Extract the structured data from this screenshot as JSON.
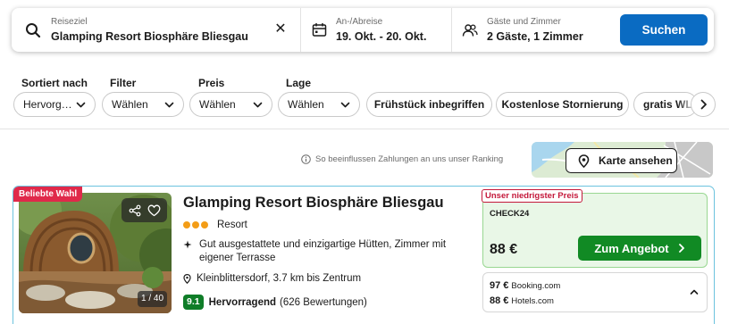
{
  "search": {
    "destination_label": "Reiseziel",
    "destination_value": "Glamping Resort Biosphäre Bliesgau",
    "dates_label": "An-/Abreise",
    "dates_value": "19. Okt. - 20. Okt.",
    "guests_label": "Gäste und Zimmer",
    "guests_value": "2 Gäste, 1 Zimmer",
    "clear_symbol": "✕",
    "search_button": "Suchen"
  },
  "filters": {
    "sort": {
      "label": "Sortiert nach",
      "value": "Hervorg…"
    },
    "filter": {
      "label": "Filter",
      "value": "Wählen"
    },
    "price": {
      "label": "Preis",
      "value": "Wählen"
    },
    "location": {
      "label": "Lage",
      "value": "Wählen"
    },
    "chips": [
      "Frühstück inbegriffen",
      "Kostenlose Stornierung",
      "gratis WLAN"
    ]
  },
  "ranking_info": "So beeinflussen Zahlungen an uns unser Ranking",
  "map_button": "Karte ansehen",
  "result": {
    "badge": "Beliebte Wahl",
    "photo_count": "1 / 40",
    "name": "Glamping Resort Biosphäre Bliesgau",
    "type": "Resort",
    "feature": "Gut ausgestattete und einzigartige Hütten, Zimmer mit eigener Terrasse",
    "location": "Kleinblittersdorf, 3.7 km bis Zentrum",
    "rating_score": "9.1",
    "rating_label": "Hervorragend",
    "rating_count": "(626 Bewertungen)",
    "offer": {
      "tag": "Unser niedrigster Preis",
      "provider": "CHECK24",
      "price": "88 €",
      "button": "Zum Angebot"
    },
    "other_offers": [
      {
        "price": "97 €",
        "provider": "Booking.com"
      },
      {
        "price": "88 €",
        "provider": "Hotels.com"
      }
    ]
  },
  "colors": {
    "primary": "#0a6bc2",
    "deal_green": "#118a24",
    "rating_green": "#0f7d28",
    "badge_red": "#e0294a",
    "star_orange": "#f39d17"
  }
}
